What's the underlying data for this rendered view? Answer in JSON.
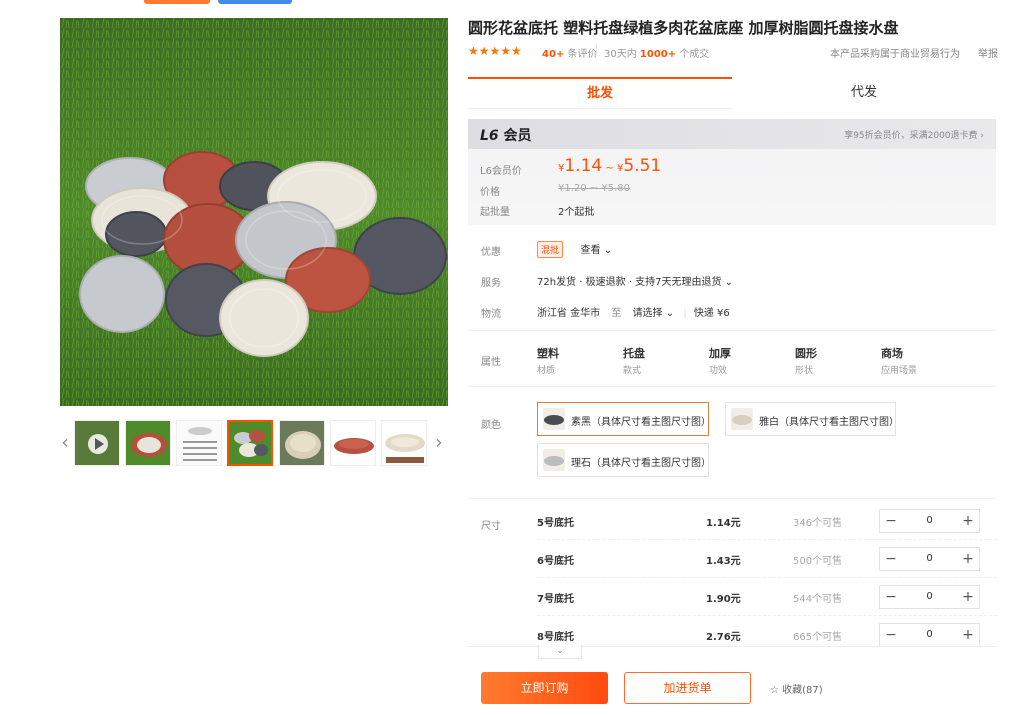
{
  "product": {
    "title": "圆形花盆底托 塑料托盘绿植多肉花盆底座 加厚树脂圆托盘接水盘",
    "stars": "★★★★★",
    "review_count": "40+",
    "review_suffix": " 条评价",
    "sep": "|",
    "sold_prefix": "30天内 ",
    "sold_count": "1000+",
    "sold_suffix": " 个成交",
    "trade_note": "本产品采购属于商业贸易行为",
    "report": "举报"
  },
  "tabs": [
    {
      "label": "批发"
    },
    {
      "label": "代发"
    }
  ],
  "price": {
    "level": "L6",
    "level_suffix": " 会员",
    "discount_note": "享95折会员价，采满2000退卡费 ›",
    "member_label": "L6会员价",
    "member_price_low": "1.14",
    "member_price_high": "5.51",
    "currency": "¥",
    "tilde": " ~ ",
    "price_label": "价格",
    "orig_price": "¥1.20 ~ ¥5.80",
    "moq_label": "起批量",
    "moq_value": "2个起批"
  },
  "promo": {
    "label": "优惠",
    "tag": "混批",
    "view": "查看 ⌄"
  },
  "service": {
    "label": "服务",
    "text": "72h发货 · 极速退款 · 支持7天无理由退货 ⌄"
  },
  "logistics": {
    "label": "物流",
    "from": "浙江省 金华市",
    "to_word": "至",
    "select": "请选择 ⌄",
    "sep": "|",
    "express": "快递 ¥6"
  },
  "attributes": {
    "label": "属性",
    "items": [
      {
        "value": "塑料",
        "key": "材质"
      },
      {
        "value": "托盘",
        "key": "款式"
      },
      {
        "value": "加厚",
        "key": "功效"
      },
      {
        "value": "圆形",
        "key": "形状"
      },
      {
        "value": "商场",
        "key": "应用场景"
      }
    ]
  },
  "colors": {
    "label": "颜色",
    "options": [
      {
        "label": "素黑（具体尺寸看主图尺寸图）",
        "swatch": "#4a4c54"
      },
      {
        "label": "雅白（具体尺寸看主图尺寸图）",
        "swatch": "#eae4d8"
      },
      {
        "label": "理石（具体尺寸看主图尺寸图）",
        "swatch": "#b9bcc0"
      }
    ]
  },
  "sizes": {
    "label": "尺寸",
    "rows": [
      {
        "name": "5号底托",
        "price": "1.14元",
        "stock": "346个可售",
        "qty": "0"
      },
      {
        "name": "6号底托",
        "price": "1.43元",
        "stock": "500个可售",
        "qty": "0"
      },
      {
        "name": "7号底托",
        "price": "1.90元",
        "stock": "544个可售",
        "qty": "0"
      },
      {
        "name": "8号底托",
        "price": "2.76元",
        "stock": "665个可售",
        "qty": "0"
      }
    ],
    "minus": "−",
    "plus": "+",
    "expand": "⌄"
  },
  "actions": {
    "order": "立即订购",
    "cart": "加进货单",
    "fav": "☆ 收藏(87)"
  },
  "thumb_nav": {
    "prev": "‹",
    "next": "›"
  },
  "colors_theme": {
    "accent": "#ff5000",
    "bg": "#ffffff"
  }
}
